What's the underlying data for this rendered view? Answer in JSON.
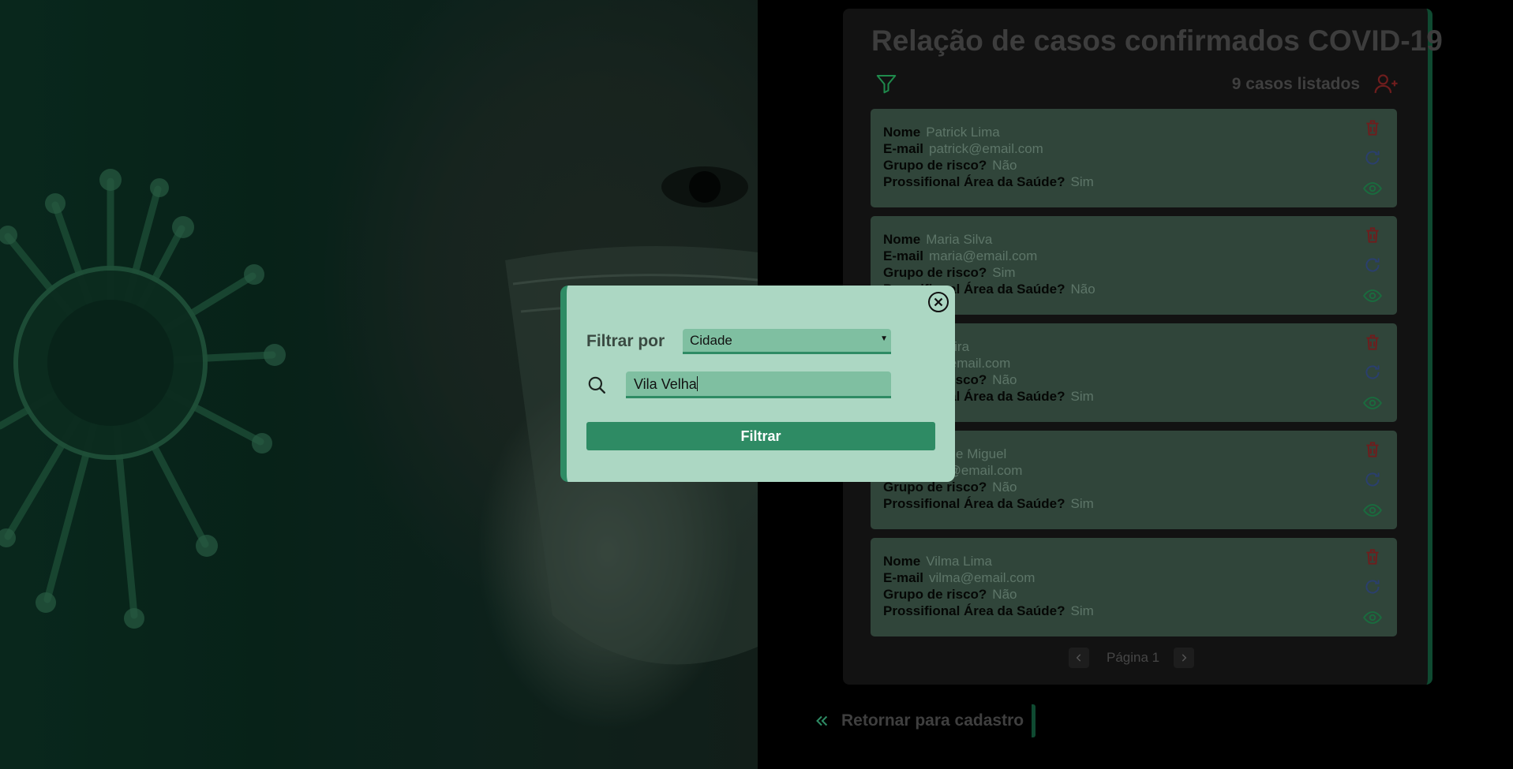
{
  "panel": {
    "title": "Relação de casos confirmados COVID-19",
    "count_text": "9 casos listados"
  },
  "card_labels": {
    "name": "Nome",
    "email": "E-mail",
    "risk": "Grupo de risco?",
    "health": "Prossifional Área da Saúde?"
  },
  "cases": [
    {
      "name": "Patrick Lima",
      "email": "patrick@email.com",
      "risk": "Não",
      "health": "Sim"
    },
    {
      "name": "Maria Silva",
      "email": "maria@email.com",
      "risk": "Sim",
      "health": "Não"
    },
    {
      "name": "Pereira",
      "email": "s@email.com",
      "risk": "Não",
      "health": "Sim"
    },
    {
      "name": "nte de Miguel",
      "email": "nte@email.com",
      "risk": "Não",
      "health": "Sim"
    },
    {
      "name": "Vilma Lima",
      "email": "vilma@email.com",
      "risk": "Não",
      "health": "Sim"
    }
  ],
  "pagination": {
    "label": "Página 1"
  },
  "return_link": {
    "label": "Retornar para cadastro"
  },
  "modal": {
    "filter_label": "Filtrar por",
    "select_value": "Cidade",
    "search_value": "Vila Velha",
    "submit_label": "Filtrar"
  },
  "colors": {
    "accent": "#2e8b64",
    "modal_bg": "#acd7c3",
    "field_bg": "#7fbfa1",
    "card_bg": "#30453a",
    "delete": "#6e1d1d",
    "update": "#2a3f6e",
    "view": "#1a6b3e"
  },
  "icons": [
    "filter-icon",
    "users-icon",
    "trash-icon",
    "refresh-icon",
    "eye-icon",
    "chevron-left-icon",
    "chevron-right-icon",
    "double-chevron-left-icon",
    "close-icon",
    "search-icon"
  ]
}
